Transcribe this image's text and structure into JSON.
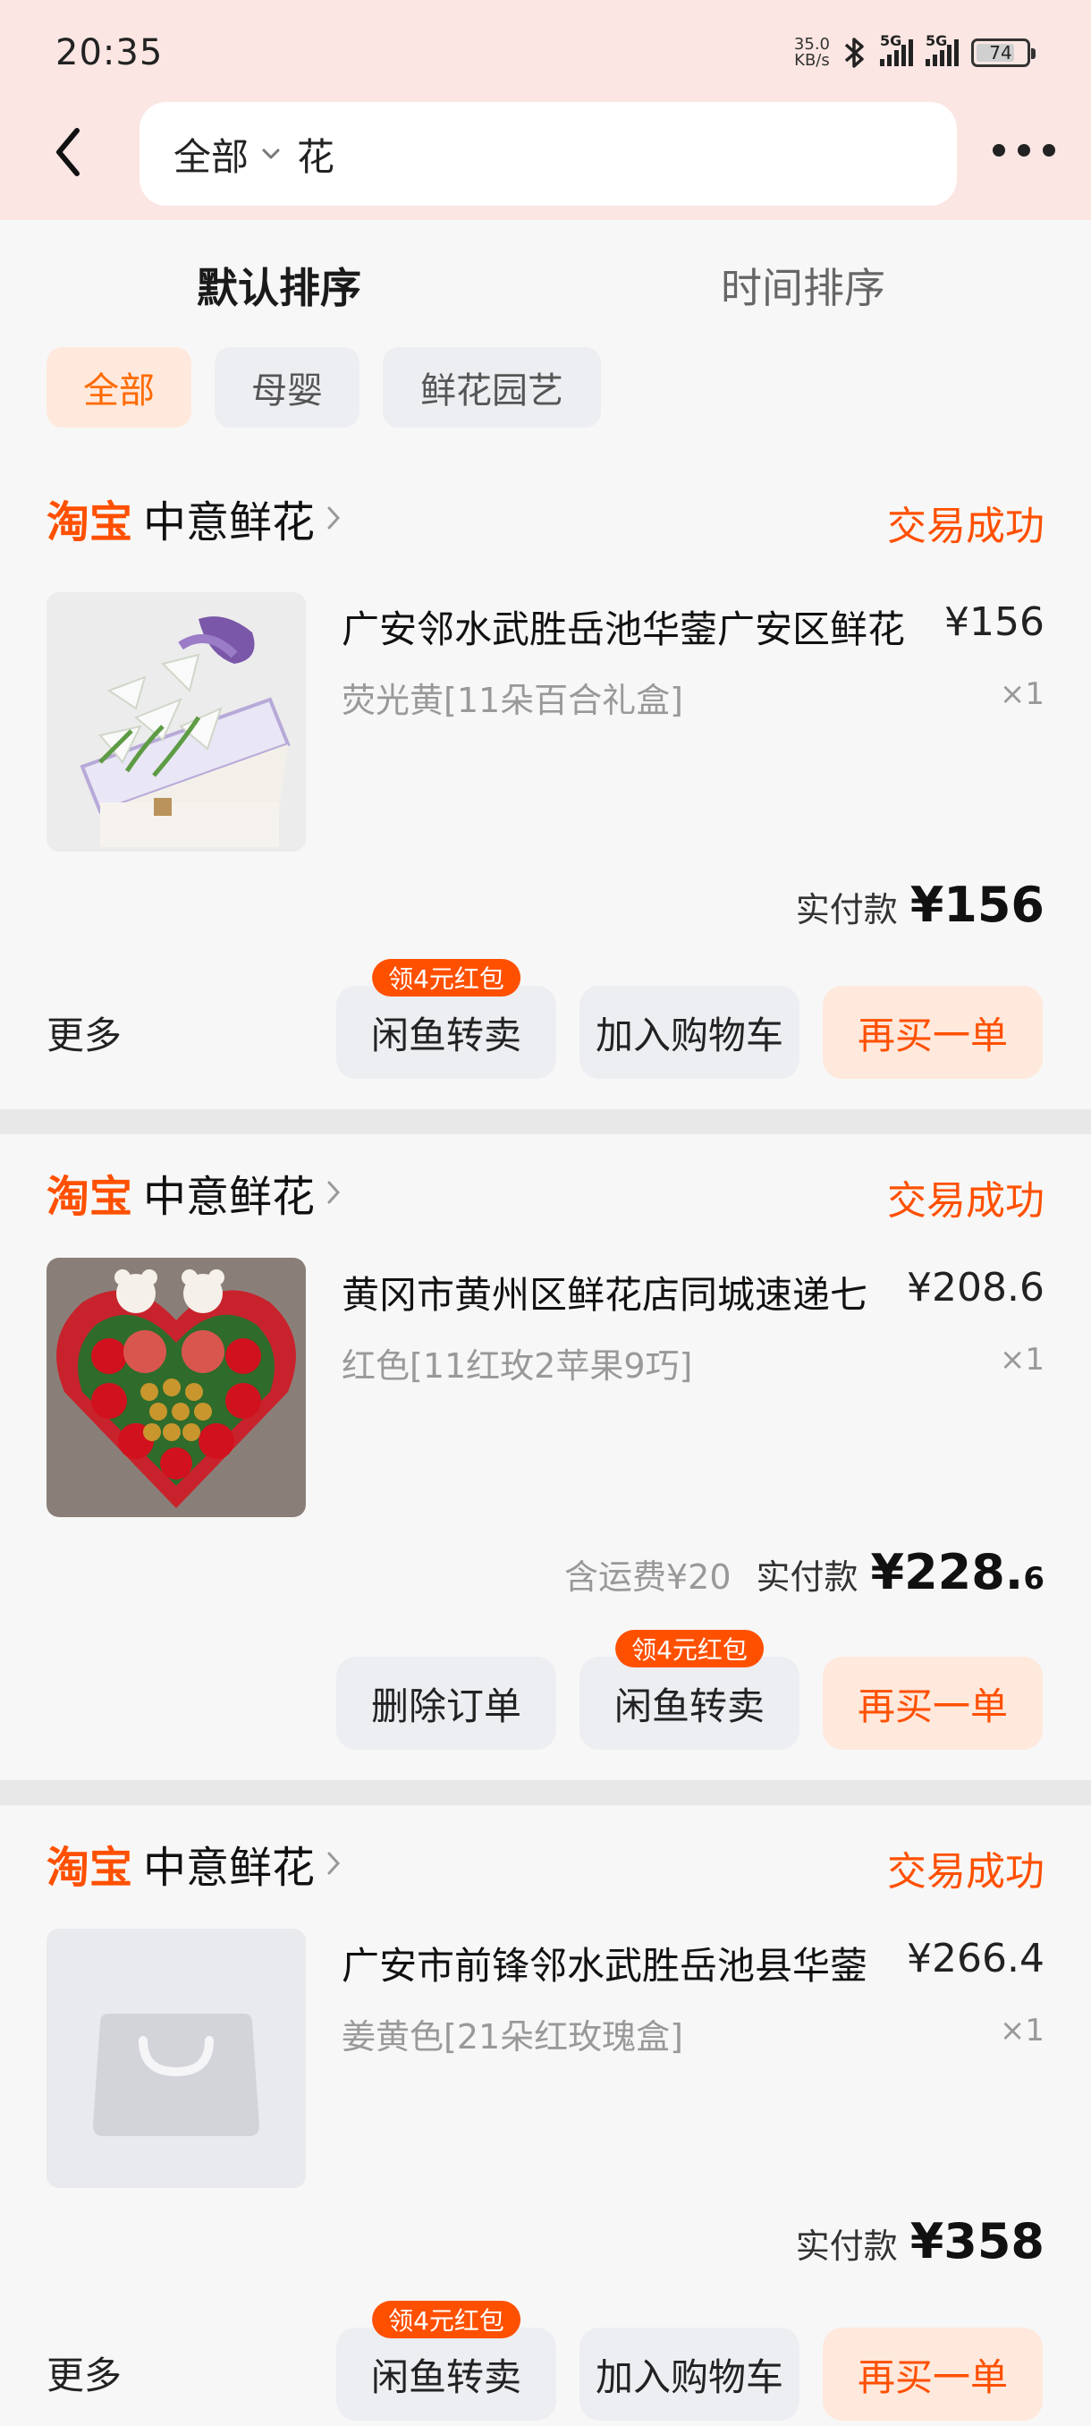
{
  "status_bar": {
    "time": "20:35",
    "net_speed": "35.0",
    "net_unit": "KB/s",
    "sim1": "5G",
    "sim2": "5G",
    "battery": "74"
  },
  "header": {
    "scope": "全部",
    "query": "花"
  },
  "sort_tabs": [
    "默认排序",
    "时间排序"
  ],
  "filters": [
    "全部",
    "母婴",
    "鲜花园艺"
  ],
  "colors": {
    "accent": "#ff5000",
    "header_bg": "#fbe6e3",
    "chip_active_bg": "#ffe8dc"
  },
  "orders": [
    {
      "platform": "淘宝",
      "shop": "中意鲜花",
      "status": "交易成功",
      "title": "广安邻水武胜岳池华蓥广安区鲜花",
      "price": "¥156",
      "sku": "荧光黄[11朵百合礼盒]",
      "qty": "×1",
      "shipping": "",
      "paid_label": "实付款",
      "paid_main": "¥156",
      "paid_dec": "",
      "more": "更多",
      "buttons": [
        "闲鱼转卖",
        "加入购物车",
        "再买一单"
      ],
      "badge": "领4元红包"
    },
    {
      "platform": "淘宝",
      "shop": "中意鲜花",
      "status": "交易成功",
      "title": "黄冈市黄州区鲜花店同城速递七",
      "price": "¥208.6",
      "sku": "红色[11红玫2苹果9巧]",
      "qty": "×1",
      "shipping": "含运费¥20",
      "paid_label": "实付款",
      "paid_main": "¥228.",
      "paid_dec": "6",
      "more": "",
      "buttons": [
        "删除订单",
        "闲鱼转卖",
        "再买一单"
      ],
      "badge": "领4元红包"
    },
    {
      "platform": "淘宝",
      "shop": "中意鲜花",
      "status": "交易成功",
      "title": "广安市前锋邻水武胜岳池县华蓥",
      "price": "¥266.4",
      "sku": "姜黄色[21朵红玫瑰盒]",
      "qty": "×1",
      "shipping": "",
      "paid_label": "实付款",
      "paid_main": "¥358",
      "paid_dec": "",
      "more": "更多",
      "buttons": [
        "闲鱼转卖",
        "加入购物车",
        "再买一单"
      ],
      "badge": "领4元红包"
    }
  ]
}
